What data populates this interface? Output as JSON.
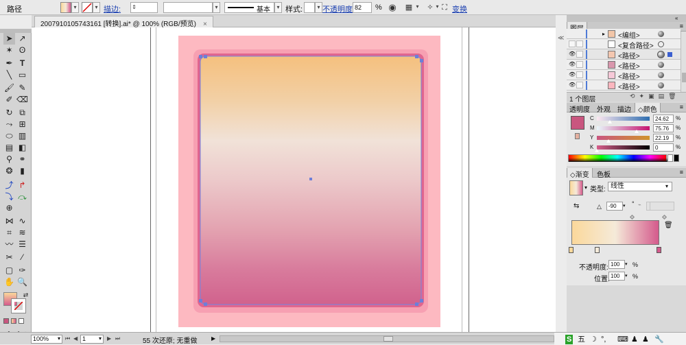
{
  "control": {
    "object_type": "路径",
    "stroke_label": "描边:",
    "brush_value": "基本",
    "style_label": "样式:",
    "opacity_label": "不透明度:",
    "opacity_value": "82",
    "opacity_unit": "%",
    "transform_label": "变换"
  },
  "document": {
    "tab_title": "2007910105743161 [转换].ai* @ 100% (RGB/预览)",
    "close": "×"
  },
  "layers_panel": {
    "title": "图层",
    "items": [
      {
        "name": "<编组>",
        "thumb_color": "#f2c6a8",
        "selected": false
      },
      {
        "name": "<复合路径>",
        "thumb_color": "#ffffff",
        "selected": false
      },
      {
        "name": "<路径>",
        "thumb_color": "#f4c7b0",
        "selected": true
      },
      {
        "name": "<路径>",
        "thumb_color": "#d997ad",
        "selected": false
      },
      {
        "name": "<路径>",
        "thumb_color": "#f6c9d8",
        "selected": false
      },
      {
        "name": "<路径>",
        "thumb_color": "#fbb6be",
        "selected": false
      }
    ],
    "footer_count": "1 个图层"
  },
  "color_panel": {
    "tabs": [
      "透明度",
      "外观",
      "描边",
      "颜色"
    ],
    "active_tab": "颜色",
    "swatch": "#c9567f",
    "channels": [
      {
        "label": "C",
        "value": "24.62",
        "percent": 24.62,
        "gradient": [
          "#fde7f0",
          "#2f6eb0"
        ]
      },
      {
        "label": "M",
        "value": "75.76",
        "percent": 75.76,
        "gradient": [
          "#e9f7fb",
          "#c5136f"
        ]
      },
      {
        "label": "Y",
        "value": "22.19",
        "percent": 22.19,
        "gradient": [
          "#c9567f",
          "#d0942c"
        ]
      },
      {
        "label": "K",
        "value": "0",
        "percent": 0,
        "gradient": [
          "#d65e8b",
          "#000000"
        ]
      }
    ],
    "unit": "%"
  },
  "gradient_panel": {
    "tabs": [
      "渐变",
      "色板"
    ],
    "active_tab": "渐变",
    "type_label": "类型:",
    "type_value": "线性",
    "angle_value": "-90",
    "angle_unit": "°",
    "opacity_label": "不透明度:",
    "opacity_value": "100",
    "position_label": "位置:",
    "position_value": "100",
    "unit": "%",
    "stops": [
      "#fbd89b",
      "#f5ead9",
      "#d45a8c"
    ]
  },
  "status": {
    "zoom": "100%",
    "artboard": "1",
    "undo_text": "55 次还原; 无重做",
    "tray": [
      "S",
      "五",
      "☽",
      "°,",
      "⌨",
      "♟",
      "♟",
      "🔧"
    ]
  },
  "colors": {
    "accent_link": "#1a3fb0",
    "selection": "#6d7fd8",
    "layer_bar": "#4f7bd6"
  }
}
